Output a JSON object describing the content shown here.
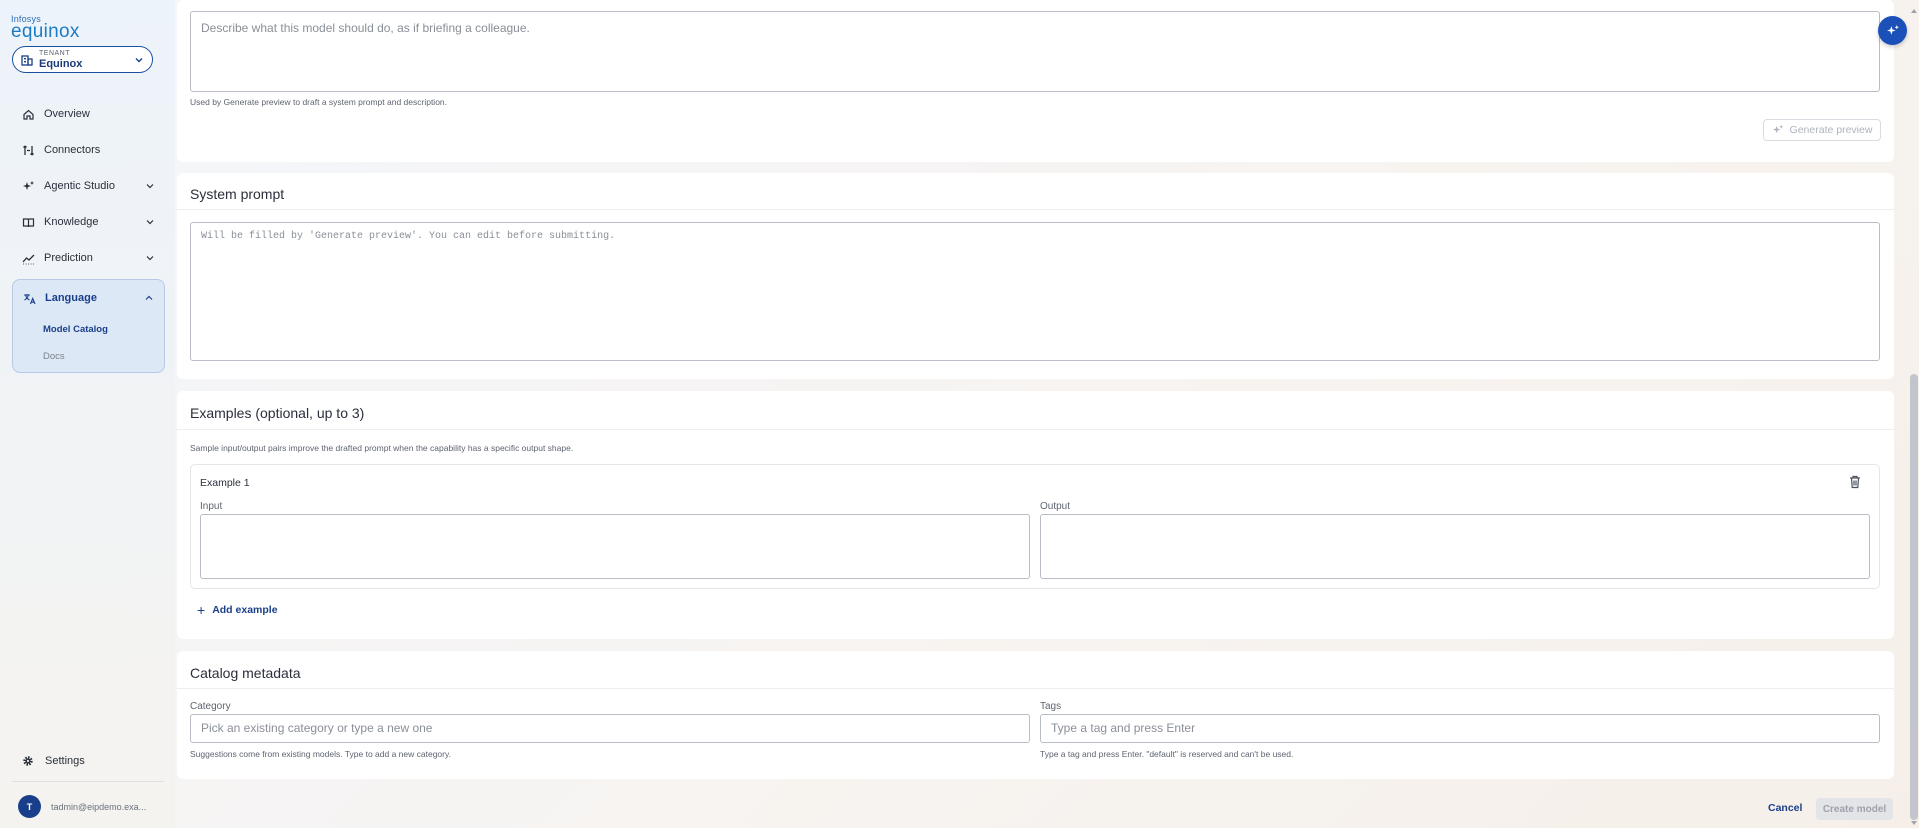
{
  "brand": {
    "top": "Infosys",
    "main": "equinox"
  },
  "tenant": {
    "label": "TENANT",
    "value": "Equinox"
  },
  "sidebar": {
    "items": [
      {
        "label": "Overview",
        "icon": "home-icon"
      },
      {
        "label": "Connectors",
        "icon": "connectors-icon"
      },
      {
        "label": "Agentic Studio",
        "icon": "sparkle-icon"
      },
      {
        "label": "Knowledge",
        "icon": "book-icon"
      },
      {
        "label": "Prediction",
        "icon": "trend-icon"
      },
      {
        "label": "Language",
        "icon": "translate-icon"
      }
    ],
    "language_sub": [
      {
        "label": "Model Catalog",
        "active": true
      },
      {
        "label": "Docs",
        "active": false
      }
    ],
    "settings": "Settings",
    "user": {
      "initial": "T",
      "email": "tadmin@eipdemo.exa..."
    }
  },
  "brief": {
    "placeholder": "Describe what this model should do, as if briefing a colleague.",
    "hint": "Used by Generate preview to draft a system prompt and description.",
    "generate_button": "Generate preview"
  },
  "system_prompt": {
    "title": "System prompt",
    "placeholder": "Will be filled by 'Generate preview'. You can edit before submitting."
  },
  "examples": {
    "title": "Examples (optional, up to 3)",
    "hint": "Sample input/output pairs improve the drafted prompt when the capability has a specific output shape.",
    "example_title": "Example 1",
    "input_label": "Input",
    "output_label": "Output",
    "add_label": "Add example"
  },
  "catalog": {
    "title": "Catalog metadata",
    "category_label": "Category",
    "category_placeholder": "Pick an existing category or type a new one",
    "category_hint": "Suggestions come from existing models. Type to add a new category.",
    "tags_label": "Tags",
    "tags_placeholder": "Type a tag and press Enter",
    "tags_hint": "Type a tag and press Enter. \"default\" is reserved and can't be used."
  },
  "footer": {
    "cancel": "Cancel",
    "create": "Create model"
  },
  "colors": {
    "accent": "#1a3f8a",
    "brand": "#1d7cc4",
    "fab": "#1a50b8"
  }
}
